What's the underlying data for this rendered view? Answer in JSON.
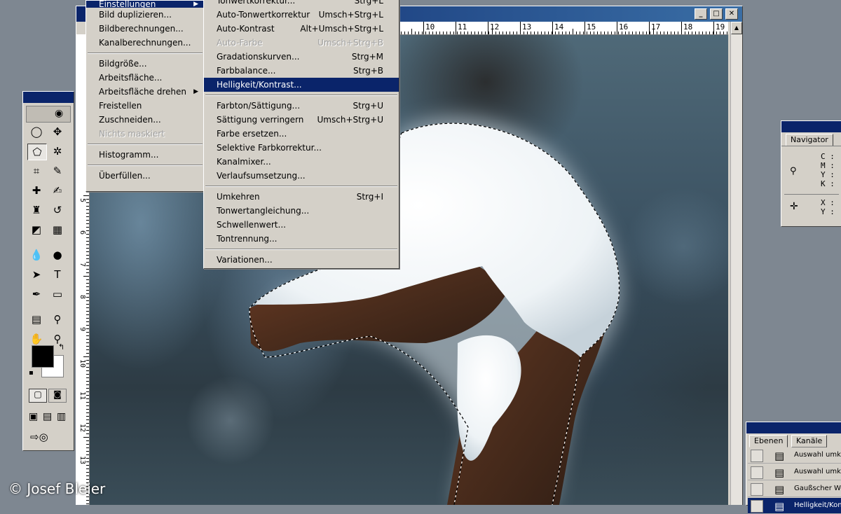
{
  "menu_bild": {
    "partial_top_label": "Einstellungen",
    "items": [
      {
        "label": "Bild duplizieren..."
      },
      {
        "label": "Bildberechnungen..."
      },
      {
        "label": "Kanalberechnungen..."
      },
      {
        "sep": true
      },
      {
        "label": "Bildgröße..."
      },
      {
        "label": "Arbeitsfläche..."
      },
      {
        "label": "Arbeitsfläche drehen",
        "submenu": true
      },
      {
        "label": "Freistellen"
      },
      {
        "label": "Zuschneiden..."
      },
      {
        "label": "Nichts maskiert",
        "disabled": true
      },
      {
        "sep": true
      },
      {
        "label": "Histogramm..."
      },
      {
        "sep": true
      },
      {
        "label": "Überfüllen..."
      }
    ]
  },
  "menu_einstellungen": {
    "items": [
      {
        "label": "Tonwertkorrektur...",
        "shortcut": "Strg+L"
      },
      {
        "label": "Auto-Tonwertkorrektur",
        "shortcut": "Umsch+Strg+L"
      },
      {
        "label": "Auto-Kontrast",
        "shortcut": "Alt+Umsch+Strg+L"
      },
      {
        "label": "Auto-Farbe",
        "shortcut": "Umsch+Strg+B",
        "disabled": true
      },
      {
        "label": "Gradationskurven...",
        "shortcut": "Strg+M"
      },
      {
        "label": "Farbbalance...",
        "shortcut": "Strg+B"
      },
      {
        "label": "Helligkeit/Kontrast...",
        "selected": true
      },
      {
        "sep": true
      },
      {
        "label": "Farbton/Sättigung...",
        "shortcut": "Strg+U"
      },
      {
        "label": "Sättigung verringern",
        "shortcut": "Umsch+Strg+U"
      },
      {
        "label": "Farbe ersetzen..."
      },
      {
        "label": "Selektive Farbkorrektur..."
      },
      {
        "label": "Kanalmixer..."
      },
      {
        "label": "Verlaufsumsetzung..."
      },
      {
        "sep": true
      },
      {
        "label": "Umkehren",
        "shortcut": "Strg+I"
      },
      {
        "label": "Tonwertangleichung..."
      },
      {
        "label": "Schwellenwert..."
      },
      {
        "label": "Tontrennung..."
      },
      {
        "sep": true
      },
      {
        "label": "Variationen..."
      }
    ]
  },
  "window_buttons": {
    "minimize": "_",
    "maximize": "□",
    "close": "✕"
  },
  "ruler_top": [
    "10",
    "11",
    "12",
    "13",
    "14",
    "15",
    "16",
    "17",
    "18",
    "19"
  ],
  "ruler_left": [
    "5",
    "6",
    "7",
    "8",
    "9",
    "10",
    "11",
    "12",
    "13"
  ],
  "navigator": {
    "tab_label": "Navigator",
    "cmyk_labels": [
      "C :",
      "M :",
      "Y :",
      "K :"
    ],
    "xy_labels": [
      "X :",
      "Y :"
    ]
  },
  "layers": {
    "tabs": [
      "Ebenen",
      "Kanäle"
    ],
    "rows": [
      {
        "name": "Auswahl umkehren"
      },
      {
        "name": "Auswahl umkehren"
      },
      {
        "name": "Gaußscher Weichzeichner"
      },
      {
        "name": "Helligkeit/Kontrast",
        "active": true
      }
    ]
  },
  "tools": [
    "lasso-icon",
    "move-icon",
    "polygon-lasso-icon",
    "magic-wand-icon",
    "crop-icon",
    "slice-icon",
    "healing-brush-icon",
    "brush-icon",
    "stamp-icon",
    "history-brush-icon",
    "eraser-icon",
    "gradient-icon",
    "blur-icon",
    "dodge-icon",
    "path-select-icon",
    "type-icon",
    "pen-icon",
    "shape-icon",
    "notes-icon",
    "eyedropper-icon",
    "hand-icon",
    "zoom-icon"
  ],
  "credit": "© Josef Bleier"
}
